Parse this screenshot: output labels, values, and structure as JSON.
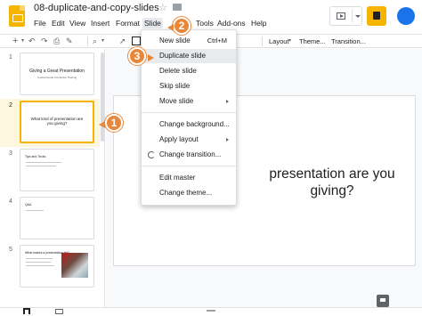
{
  "doc": {
    "title": "08-duplicate-and-copy-slides"
  },
  "menubar": {
    "items": [
      "File",
      "Edit",
      "View",
      "Insert",
      "Format",
      "Slide",
      "Arrange",
      "Tools",
      "Add-ons",
      "Help"
    ],
    "visible": {
      "file": "File",
      "edit": "Edit",
      "view": "View",
      "insert": "Insert",
      "format": "Format",
      "slide": "Slide",
      "tools": "Tools",
      "addons": "Add-ons",
      "help": "Help"
    }
  },
  "toolbar": {
    "layout": "Layout",
    "theme": "Theme...",
    "transition": "Transition...",
    "add": "+"
  },
  "slide_menu": {
    "new_slide": "New slide",
    "new_slide_shortcut": "Ctrl+M",
    "duplicate_slide": "Duplicate slide",
    "delete_slide": "Delete slide",
    "skip_slide": "Skip slide",
    "move_slide": "Move slide",
    "change_background": "Change background...",
    "apply_layout": "Apply layout",
    "change_transition": "Change transition...",
    "edit_master": "Edit master",
    "change_theme": "Change theme..."
  },
  "filmstrip": {
    "slides": [
      {
        "num": "1",
        "title": "Giving a Great Presentation",
        "subtitle": "CustomGuide interactive Training"
      },
      {
        "num": "2",
        "title": "What kind of presentation are you giving?"
      },
      {
        "num": "3",
        "title": "Tips and Tricks"
      },
      {
        "num": "4",
        "title": "Q&A"
      },
      {
        "num": "5",
        "title": "What makes a presentation fail?"
      }
    ]
  },
  "canvas": {
    "slide_text_line1": "presentation are you",
    "slide_text_line2": "giving?"
  },
  "callouts": {
    "one": "1",
    "two": "2",
    "three": "3"
  },
  "colors": {
    "accent": "#f4b400",
    "callout": "#e8873a",
    "selection": "#fef7e0"
  },
  "icons": [
    "slides-logo-icon",
    "star-icon",
    "folder-icon",
    "present-icon",
    "share-icon",
    "undo-icon",
    "redo-icon",
    "print-icon",
    "paint-format-icon",
    "zoom-icon",
    "cursor-icon",
    "textbox-icon",
    "transition-icon",
    "speaker-notes-icon",
    "grid-view-icon",
    "filmstrip-view-icon"
  ]
}
